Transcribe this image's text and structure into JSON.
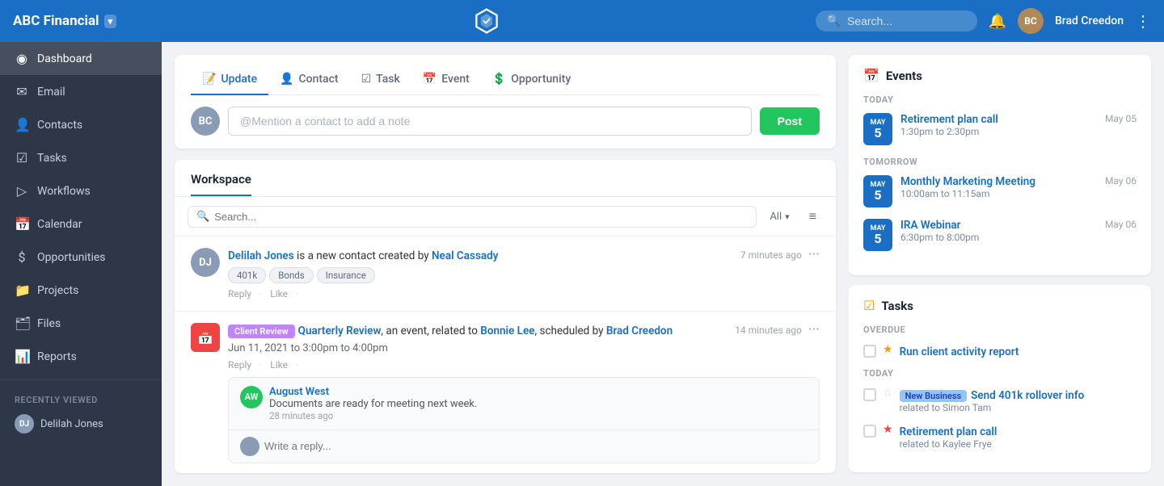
{
  "topnav": {
    "brand": "ABC Financial",
    "caret": "▾",
    "search_placeholder": "Search...",
    "username": "Brad Creedon",
    "more_icon": "⋮",
    "bell_icon": "🔔"
  },
  "sidebar": {
    "items": [
      {
        "id": "dashboard",
        "label": "Dashboard",
        "icon": "◉",
        "active": true
      },
      {
        "id": "email",
        "label": "Email",
        "icon": "✉"
      },
      {
        "id": "contacts",
        "label": "Contacts",
        "icon": "👤"
      },
      {
        "id": "tasks",
        "label": "Tasks",
        "icon": "☑"
      },
      {
        "id": "workflows",
        "label": "Workflows",
        "icon": "▷"
      },
      {
        "id": "calendar",
        "label": "Calendar",
        "icon": "📅"
      },
      {
        "id": "opportunities",
        "label": "Opportunities",
        "icon": "$"
      },
      {
        "id": "projects",
        "label": "Projects",
        "icon": "📁"
      },
      {
        "id": "files",
        "label": "Files",
        "icon": "🗂"
      },
      {
        "id": "reports",
        "label": "Reports",
        "icon": "📊"
      }
    ],
    "recently_viewed_label": "RECENTLY VIEWED",
    "recent_items": [
      {
        "id": "delilah",
        "label": "Delilah Jones",
        "initials": "DJ",
        "color": "#8a9bb5"
      },
      {
        "id": "person2",
        "label": "...",
        "initials": "?",
        "color": "#6b7a8d"
      }
    ]
  },
  "post_card": {
    "tabs": [
      {
        "id": "update",
        "label": "Update",
        "icon": "📝",
        "active": true
      },
      {
        "id": "contact",
        "label": "Contact",
        "icon": "👤"
      },
      {
        "id": "task",
        "label": "Task",
        "icon": "☑"
      },
      {
        "id": "event",
        "label": "Event",
        "icon": "📅"
      },
      {
        "id": "opportunity",
        "label": "Opportunity",
        "icon": "💲"
      }
    ],
    "input_placeholder": "@Mention a contact to add a note",
    "post_button": "Post"
  },
  "workspace": {
    "title": "Workspace",
    "search_placeholder": "Search...",
    "filter_label": "All",
    "feed": [
      {
        "id": "feed1",
        "avatar_initials": "DJ",
        "avatar_color": "#8a9bb5",
        "html_text": "<a>Delilah Jones</a> is a new contact created by <a>Neal Cassady</a>",
        "time": "7 minutes ago",
        "tags": [
          "401k",
          "Bonds",
          "Insurance"
        ],
        "actions": [
          "Reply",
          "Like"
        ]
      },
      {
        "id": "feed2",
        "is_event": true,
        "event_badge": "Client Review",
        "html_text": "<a>Quarterly Review</a>, an event, related to <a>Bonnie Lee</a>, scheduled by <a>Brad Creedon</a>",
        "time": "14 minutes ago",
        "date": "Jun 11, 2021 to 3:00pm to 4:00pm",
        "actions": [
          "Reply",
          "Like"
        ],
        "nested": [
          {
            "id": "n1",
            "name": "August West",
            "avatar_color": "#22c55e",
            "initials": "AW",
            "message": "Documents are ready for meeting next week.",
            "time": "28 minutes ago"
          }
        ],
        "reply_placeholder": "Write a reply..."
      }
    ]
  },
  "events_panel": {
    "title": "Events",
    "icon": "📅",
    "sections": [
      {
        "label": "TODAY",
        "events": [
          {
            "id": "ev1",
            "month": "MAY",
            "day": "5",
            "name": "Retirement plan call",
            "time": "1:30pm to 2:30pm",
            "date_label": "May 05"
          }
        ]
      },
      {
        "label": "TOMORROW",
        "events": [
          {
            "id": "ev2",
            "month": "MAY",
            "day": "5",
            "name": "Monthly Marketing Meeting",
            "time": "10:00am to 11:15am",
            "date_label": "May 06"
          },
          {
            "id": "ev3",
            "month": "MAY",
            "day": "5",
            "name": "IRA Webinar",
            "time": "6:30pm to 8:00pm",
            "date_label": "May 06"
          }
        ]
      }
    ]
  },
  "tasks_panel": {
    "title": "Tasks",
    "icon": "☑",
    "sections": [
      {
        "label": "OVERDUE",
        "tasks": [
          {
            "id": "t1",
            "star": "★",
            "star_filled": true,
            "name": "Run client activity report",
            "related": null,
            "badge": null,
            "priority_color": "#f59e0b"
          }
        ]
      },
      {
        "label": "TODAY",
        "tasks": [
          {
            "id": "t2",
            "star": "☆",
            "star_filled": false,
            "name": "Send 401k rollover info",
            "related": "related to Simon Tam",
            "badge": "New Business",
            "priority_color": null
          },
          {
            "id": "t3",
            "star": "★",
            "star_filled": true,
            "name": "Retirement plan call",
            "related": "related to Kaylee Frye",
            "badge": null,
            "priority_color": "#ef4444"
          }
        ]
      }
    ]
  }
}
